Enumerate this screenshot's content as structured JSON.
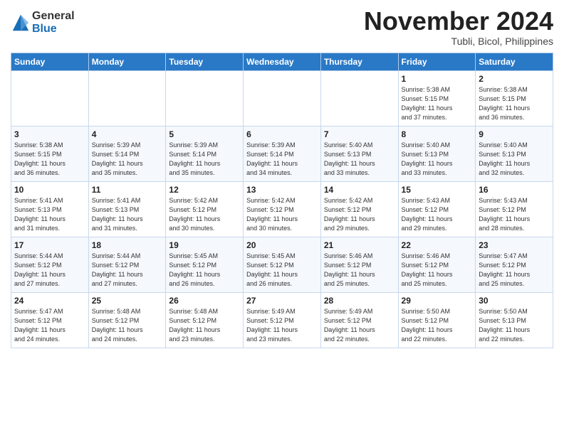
{
  "logo": {
    "general": "General",
    "blue": "Blue"
  },
  "title": "November 2024",
  "location": "Tubli, Bicol, Philippines",
  "headers": [
    "Sunday",
    "Monday",
    "Tuesday",
    "Wednesday",
    "Thursday",
    "Friday",
    "Saturday"
  ],
  "weeks": [
    [
      {
        "day": "",
        "info": ""
      },
      {
        "day": "",
        "info": ""
      },
      {
        "day": "",
        "info": ""
      },
      {
        "day": "",
        "info": ""
      },
      {
        "day": "",
        "info": ""
      },
      {
        "day": "1",
        "info": "Sunrise: 5:38 AM\nSunset: 5:15 PM\nDaylight: 11 hours\nand 37 minutes."
      },
      {
        "day": "2",
        "info": "Sunrise: 5:38 AM\nSunset: 5:15 PM\nDaylight: 11 hours\nand 36 minutes."
      }
    ],
    [
      {
        "day": "3",
        "info": "Sunrise: 5:38 AM\nSunset: 5:15 PM\nDaylight: 11 hours\nand 36 minutes."
      },
      {
        "day": "4",
        "info": "Sunrise: 5:39 AM\nSunset: 5:14 PM\nDaylight: 11 hours\nand 35 minutes."
      },
      {
        "day": "5",
        "info": "Sunrise: 5:39 AM\nSunset: 5:14 PM\nDaylight: 11 hours\nand 35 minutes."
      },
      {
        "day": "6",
        "info": "Sunrise: 5:39 AM\nSunset: 5:14 PM\nDaylight: 11 hours\nand 34 minutes."
      },
      {
        "day": "7",
        "info": "Sunrise: 5:40 AM\nSunset: 5:13 PM\nDaylight: 11 hours\nand 33 minutes."
      },
      {
        "day": "8",
        "info": "Sunrise: 5:40 AM\nSunset: 5:13 PM\nDaylight: 11 hours\nand 33 minutes."
      },
      {
        "day": "9",
        "info": "Sunrise: 5:40 AM\nSunset: 5:13 PM\nDaylight: 11 hours\nand 32 minutes."
      }
    ],
    [
      {
        "day": "10",
        "info": "Sunrise: 5:41 AM\nSunset: 5:13 PM\nDaylight: 11 hours\nand 31 minutes."
      },
      {
        "day": "11",
        "info": "Sunrise: 5:41 AM\nSunset: 5:13 PM\nDaylight: 11 hours\nand 31 minutes."
      },
      {
        "day": "12",
        "info": "Sunrise: 5:42 AM\nSunset: 5:12 PM\nDaylight: 11 hours\nand 30 minutes."
      },
      {
        "day": "13",
        "info": "Sunrise: 5:42 AM\nSunset: 5:12 PM\nDaylight: 11 hours\nand 30 minutes."
      },
      {
        "day": "14",
        "info": "Sunrise: 5:42 AM\nSunset: 5:12 PM\nDaylight: 11 hours\nand 29 minutes."
      },
      {
        "day": "15",
        "info": "Sunrise: 5:43 AM\nSunset: 5:12 PM\nDaylight: 11 hours\nand 29 minutes."
      },
      {
        "day": "16",
        "info": "Sunrise: 5:43 AM\nSunset: 5:12 PM\nDaylight: 11 hours\nand 28 minutes."
      }
    ],
    [
      {
        "day": "17",
        "info": "Sunrise: 5:44 AM\nSunset: 5:12 PM\nDaylight: 11 hours\nand 27 minutes."
      },
      {
        "day": "18",
        "info": "Sunrise: 5:44 AM\nSunset: 5:12 PM\nDaylight: 11 hours\nand 27 minutes."
      },
      {
        "day": "19",
        "info": "Sunrise: 5:45 AM\nSunset: 5:12 PM\nDaylight: 11 hours\nand 26 minutes."
      },
      {
        "day": "20",
        "info": "Sunrise: 5:45 AM\nSunset: 5:12 PM\nDaylight: 11 hours\nand 26 minutes."
      },
      {
        "day": "21",
        "info": "Sunrise: 5:46 AM\nSunset: 5:12 PM\nDaylight: 11 hours\nand 25 minutes."
      },
      {
        "day": "22",
        "info": "Sunrise: 5:46 AM\nSunset: 5:12 PM\nDaylight: 11 hours\nand 25 minutes."
      },
      {
        "day": "23",
        "info": "Sunrise: 5:47 AM\nSunset: 5:12 PM\nDaylight: 11 hours\nand 25 minutes."
      }
    ],
    [
      {
        "day": "24",
        "info": "Sunrise: 5:47 AM\nSunset: 5:12 PM\nDaylight: 11 hours\nand 24 minutes."
      },
      {
        "day": "25",
        "info": "Sunrise: 5:48 AM\nSunset: 5:12 PM\nDaylight: 11 hours\nand 24 minutes."
      },
      {
        "day": "26",
        "info": "Sunrise: 5:48 AM\nSunset: 5:12 PM\nDaylight: 11 hours\nand 23 minutes."
      },
      {
        "day": "27",
        "info": "Sunrise: 5:49 AM\nSunset: 5:12 PM\nDaylight: 11 hours\nand 23 minutes."
      },
      {
        "day": "28",
        "info": "Sunrise: 5:49 AM\nSunset: 5:12 PM\nDaylight: 11 hours\nand 22 minutes."
      },
      {
        "day": "29",
        "info": "Sunrise: 5:50 AM\nSunset: 5:12 PM\nDaylight: 11 hours\nand 22 minutes."
      },
      {
        "day": "30",
        "info": "Sunrise: 5:50 AM\nSunset: 5:13 PM\nDaylight: 11 hours\nand 22 minutes."
      }
    ]
  ]
}
